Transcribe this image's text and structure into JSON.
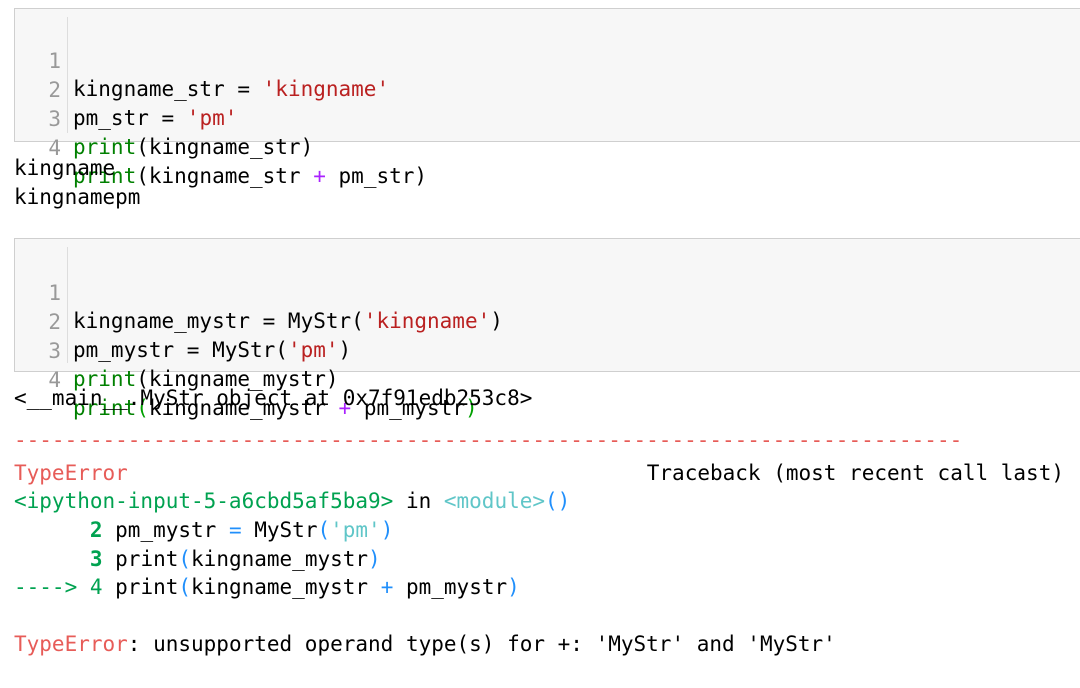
{
  "cell1": {
    "lines": [
      {
        "num": "1",
        "a": "kingname_str = ",
        "s": "'kingname'"
      },
      {
        "num": "2",
        "a": "pm_str = ",
        "s": "'pm'"
      },
      {
        "num": "3",
        "kw": "print",
        "rest": "(kingname_str)"
      },
      {
        "num": "4",
        "kw": "print",
        "rest1": "(kingname_str ",
        "op": "+",
        "rest2": " pm_str)"
      }
    ]
  },
  "output1": [
    "kingname",
    "kingnamepm"
  ],
  "cell2": {
    "lines": [
      {
        "num": "1",
        "a": "kingname_mystr = MyStr(",
        "s": "'kingname'",
        "b": ")"
      },
      {
        "num": "2",
        "a": "pm_mystr = MyStr(",
        "s": "'pm'",
        "b": ")"
      },
      {
        "num": "3",
        "kw": "print",
        "rest": "(kingname_mystr)"
      },
      {
        "num": "4",
        "kw": "print",
        "p1": "(",
        "rest1": "kingname_mystr ",
        "op": "+",
        "rest2": " pm_mystr",
        "p2": ")"
      }
    ]
  },
  "output2": {
    "object_line": "<__main__.MyStr object at 0x7f91edb253c8>",
    "dashes": "---------------------------------------------------------------------------",
    "error_name": "TypeError",
    "traceback_label": "Traceback (most recent call last)",
    "input_ref": "<ipython-input-5-a6cbd5af5ba9>",
    "in_text": " in ",
    "module": "<module>",
    "module_parens": "()",
    "tb_lines": [
      {
        "prefix": "      ",
        "num": "2",
        "t1": " pm_mystr ",
        "eq": "=",
        "t2": " MyStr",
        "p1": "(",
        "s": "'pm'",
        "p2": ")"
      },
      {
        "prefix": "      ",
        "num": "3",
        "t1": " print",
        "p1": "(",
        "t2": "kingname_mystr",
        "p2": ")"
      },
      {
        "prefix": "----> ",
        "num": "4",
        "t1": " print",
        "p1": "(",
        "t2": "kingname_mystr ",
        "op": "+",
        "t3": " pm_mystr",
        "p2": ")"
      }
    ],
    "final_error": "TypeError",
    "final_message": ": unsupported operand type(s) for +: 'MyStr' and 'MyStr'"
  },
  "colors": {
    "string": "#ba2121",
    "keyword": "#008000",
    "operator": "#aa22ff",
    "traceback_red": "#e75c58",
    "traceback_green": "#00a250",
    "traceback_cyan": "#60c6c8",
    "traceback_blue": "#208ffb"
  }
}
